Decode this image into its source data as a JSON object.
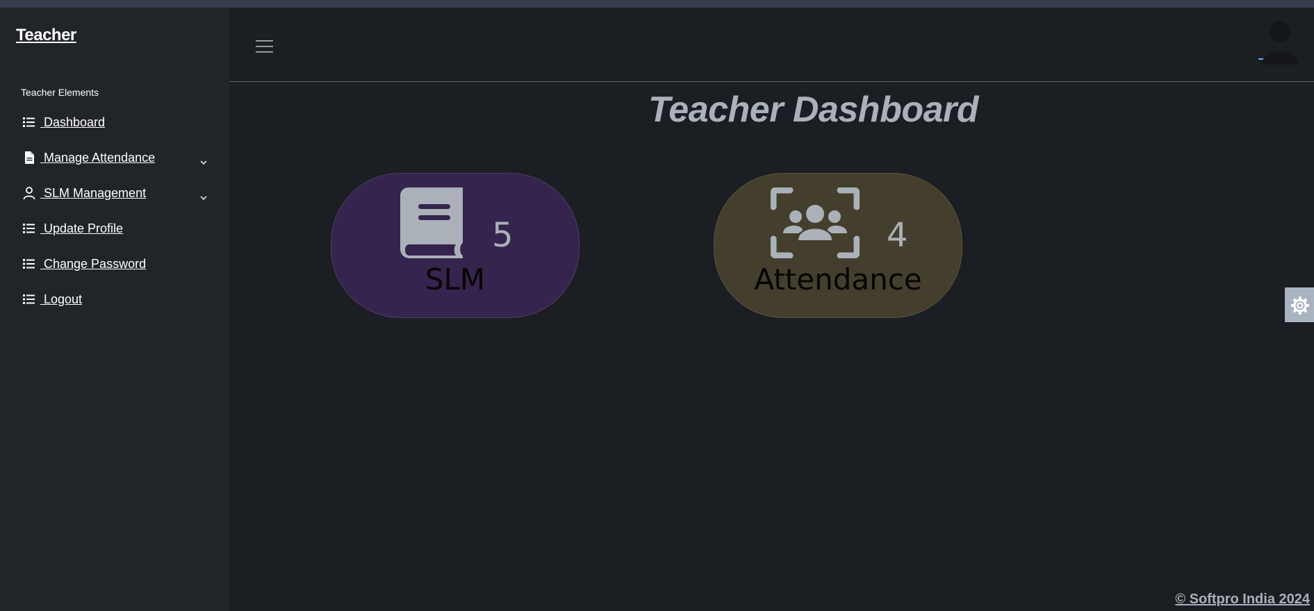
{
  "brand": "Teacher",
  "sidebar": {
    "section_label": "Teacher Elements",
    "items": [
      {
        "label": " Dashboard",
        "icon": "list-icon",
        "has_submenu": false
      },
      {
        "label": " Manage Attendance",
        "icon": "file-icon",
        "has_submenu": true
      },
      {
        "label": " SLM Management",
        "icon": "user-icon",
        "has_submenu": true
      },
      {
        "label": " Update Profile",
        "icon": "list-icon",
        "has_submenu": false
      },
      {
        "label": " Change Password",
        "icon": "list-icon",
        "has_submenu": false
      },
      {
        "label": " Logout",
        "icon": "list-icon",
        "has_submenu": false
      }
    ]
  },
  "header": {
    "menu_icon": "hamburger-icon",
    "avatar_icon": "user-avatar-icon"
  },
  "main": {
    "title": "Teacher Dashboard",
    "cards": [
      {
        "label": "SLM",
        "count": "5",
        "icon": "book-icon",
        "color": "#35244d"
      },
      {
        "label": "Attendance",
        "count": "4",
        "icon": "users-viewfinder-icon",
        "color": "#443e2c"
      }
    ]
  },
  "settings_icon": "gear-icon",
  "footer": "© Softpro India 2024",
  "colors": {
    "background": "#1b1e22",
    "sidebar": "#212429",
    "text_muted": "#aab1b8"
  }
}
